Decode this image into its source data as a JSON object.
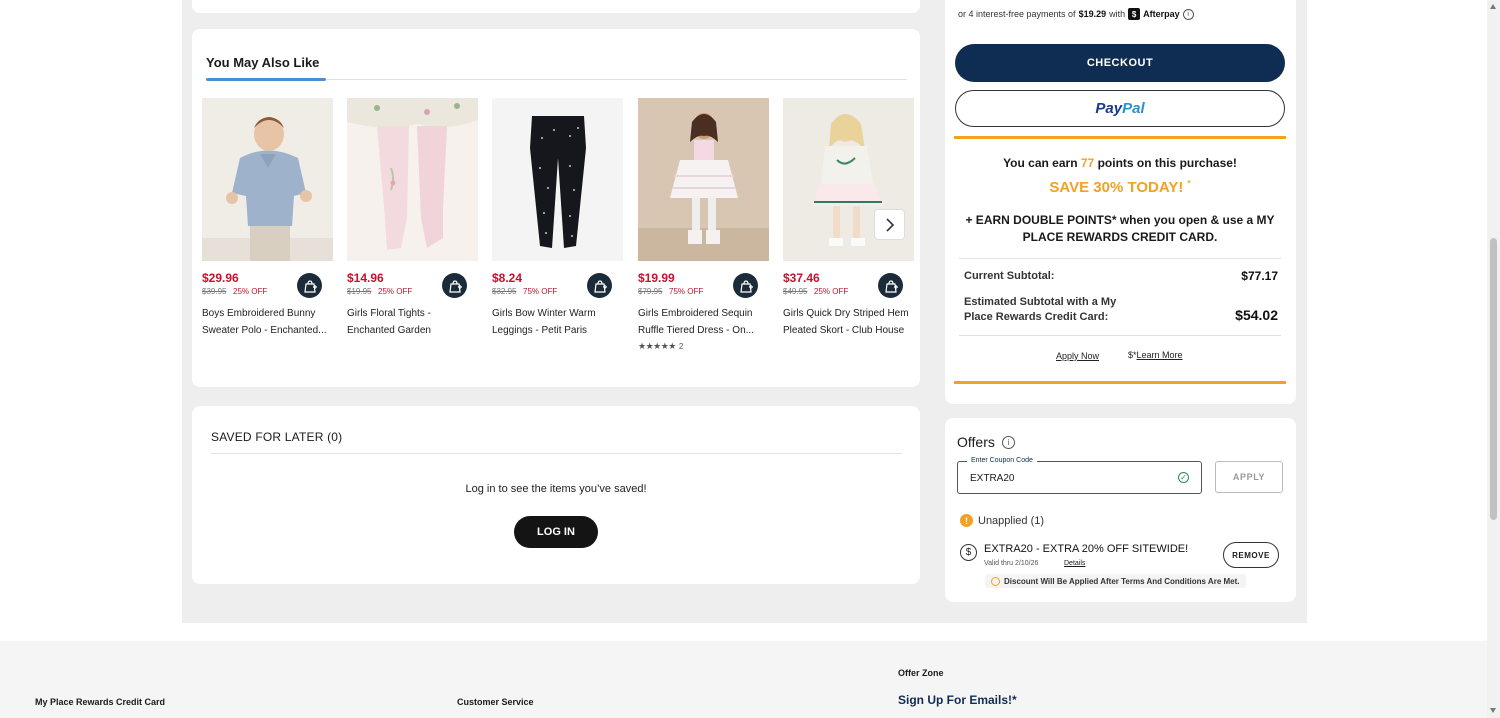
{
  "recommendations": {
    "tab_label": "You May Also Like",
    "products": [
      {
        "price": "$29.96",
        "original": "$39.95",
        "discount": "25% OFF",
        "name": "Boys Embroidered Bunny Sweater Polo - Enchanted...",
        "image": "boy-blue-polo-photo"
      },
      {
        "price": "$14.96",
        "original": "$19.95",
        "discount": "25% OFF",
        "name": "Girls Floral Tights - Enchanted Garden",
        "image": "pink-floral-tights-photo"
      },
      {
        "price": "$8.24",
        "original": "$32.95",
        "discount": "75% OFF",
        "name": "Girls Bow Winter Warm Leggings - Petit Paris",
        "image": "black-bow-leggings-photo"
      },
      {
        "price": "$19.99",
        "original": "$79.95",
        "discount": "75% OFF",
        "name": "Girls Embroidered Sequin Ruffle Tiered Dress - On...",
        "image": "girl-tulle-dress-photo",
        "rating": 5,
        "reviews": "2"
      },
      {
        "price": "$37.46",
        "original": "$49.95",
        "discount": "25% OFF",
        "name": "Girls Quick Dry Striped Hem Pleated Skort - Club House",
        "image": "girl-sweater-skort-photo"
      }
    ]
  },
  "saved_for_later": {
    "title": "SAVED FOR LATER (0)",
    "message": "Log in to see the items you’ve saved!",
    "login_label": "LOG IN"
  },
  "summary": {
    "afterpay_prefix": "or 4 interest-free payments of",
    "afterpay_amount": "$19.29",
    "afterpay_with": "with",
    "afterpay_brand": "Afterpay",
    "checkout_label": "CHECKOUT",
    "paypal_pay": "Pay",
    "paypal_pal": "Pal",
    "earn_prefix": "You can earn",
    "earn_points": "77",
    "earn_suffix": "points on this purchase!",
    "save_today": "SAVE 30% TODAY!",
    "save_mark": "*",
    "double_points": "+ EARN DOUBLE POINTS* when you open & use a MY PLACE REWARDS CREDIT CARD.",
    "current_subtotal_label": "Current Subtotal:",
    "current_subtotal_value": "$77.17",
    "estimated_label": "Estimated Subtotal with a My Place Rewards Credit Card:",
    "estimated_value": "$54.02",
    "apply_now": "Apply Now",
    "learn_more_mark": "$*",
    "learn_more": "Learn More"
  },
  "offers": {
    "title": "Offers",
    "coupon_label": "Enter Coupon Code",
    "coupon_value": "EXTRA20",
    "apply_label": "APPLY",
    "unapplied": "Unapplied (1)",
    "coupon_name": "EXTRA20 - EXTRA 20% OFF SITEWIDE!",
    "valid": "Valid thru 2/10/26",
    "details": "Details",
    "remove_label": "REMOVE",
    "note": "Discount Will Be Applied After Terms And Conditions Are Met."
  },
  "footer": {
    "offer_zone": "Offer Zone",
    "signup": "Sign Up For Emails!*",
    "rewards_card": "My Place Rewards Credit Card",
    "customer_service": "Customer Service"
  },
  "colors": {
    "sale_red": "#c8102e",
    "navy": "#0f2d52",
    "orange": "#f2a123",
    "tab_blue": "#4a8fd6"
  }
}
